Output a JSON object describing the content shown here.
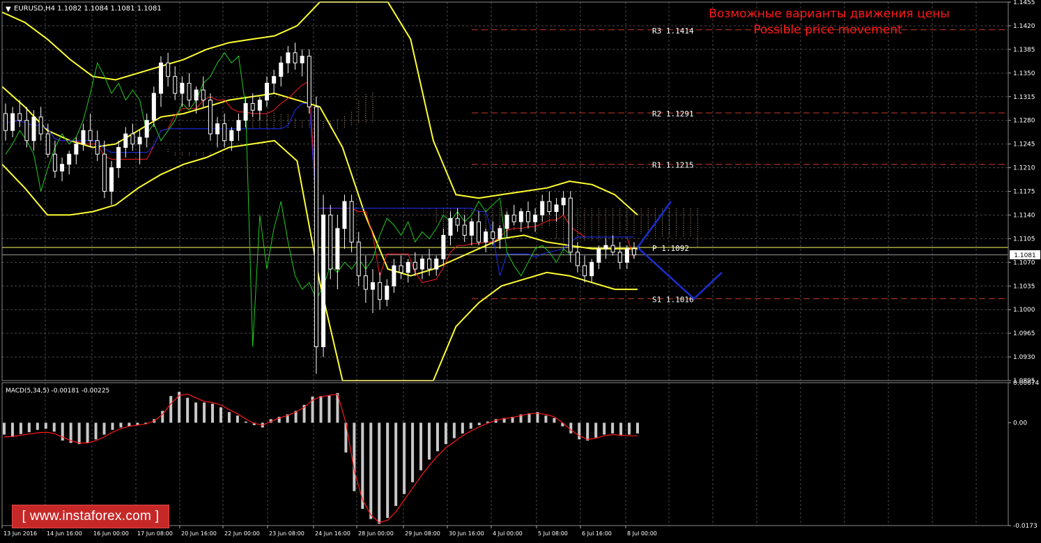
{
  "window": {
    "symbol_info": "EURUSD,H4  1.1082 1.1084 1.1081 1.1081",
    "indicator_info": "MACD(5,34,5) -0.00181 -0.00225",
    "current_price": "1.1081",
    "annotation_ru": "Возможные варианты движения цены",
    "annotation_en": "Possible price movement",
    "watermark": "[ www.instaforex.com ]"
  },
  "colors": {
    "background": "#000000",
    "grid": "#4a4a4a",
    "axis_text": "#ffffff",
    "bull_candle": "#ffffff",
    "bear_candle": "#000000",
    "bollinger": "#ffff33",
    "ichimoku_tenkan": "#ff2020",
    "ichimoku_kijun": "#2030ff",
    "ichimoku_chikou": "#22cc22",
    "kumo": "#d9a88a",
    "pivot_levels": "#c83a28",
    "pivot_line": "#ffff66",
    "forecast": "#1a2fd0",
    "macd_hist": "#c8c8c8",
    "macd_signal": "#ff1a1a",
    "annotation": "#ff1a1a"
  },
  "chart_data": [
    {
      "type": "candlestick",
      "symbol": "EURUSD",
      "timeframe": "H4",
      "ylim": [
        1.0895,
        1.1455
      ],
      "y_ticks": [
        "1.1455",
        "1.1420",
        "1.1385",
        "1.1350",
        "1.1315",
        "1.1280",
        "1.1245",
        "1.1210",
        "1.1175",
        "1.1140",
        "1.1105",
        "1.1070",
        "1.1035",
        "1.1000",
        "1.0965",
        "1.0930",
        "1.0895"
      ],
      "x_ticks": [
        "13 Jun 2016",
        "14 Jun 16:00",
        "16 Jun 00:00",
        "17 Jun 08:00",
        "20 Jun 16:00",
        "22 Jun 00:00",
        "23 Jun 08:00",
        "24 Jun 16:00",
        "28 Jun 00:00",
        "29 Jun 08:00",
        "30 Jun 16:00",
        "4 Jul 00:00",
        "5 Jul 08:00",
        "6 Jul 16:00",
        "8 Jul 00:00"
      ],
      "levels": [
        {
          "label": "R3",
          "value": 1.1414
        },
        {
          "label": "R2",
          "value": 1.1291
        },
        {
          "label": "R1",
          "value": 1.1215
        },
        {
          "label": "P",
          "value": 1.1092
        },
        {
          "label": "S1",
          "value": 1.1016
        }
      ],
      "level_labels": [
        "R3  1.1414",
        "R2  1.1291",
        "R1  1.1215",
        "P  1.1092",
        "S1  1.1016"
      ],
      "last_price": 1.1081,
      "candles_ohlc": [
        [
          1.129,
          1.1305,
          1.125,
          1.1265
        ],
        [
          1.1265,
          1.13,
          1.1255,
          1.129
        ],
        [
          1.129,
          1.131,
          1.127,
          1.128
        ],
        [
          1.128,
          1.13,
          1.124,
          1.125
        ],
        [
          1.125,
          1.1295,
          1.1235,
          1.1285
        ],
        [
          1.1285,
          1.13,
          1.125,
          1.126
        ],
        [
          1.126,
          1.1275,
          1.1225,
          1.123
        ],
        [
          1.123,
          1.125,
          1.1195,
          1.1205
        ],
        [
          1.1205,
          1.1225,
          1.119,
          1.1215
        ],
        [
          1.1215,
          1.1235,
          1.12,
          1.123
        ],
        [
          1.123,
          1.1255,
          1.1215,
          1.1245
        ],
        [
          1.1245,
          1.1275,
          1.1235,
          1.1265
        ],
        [
          1.1265,
          1.129,
          1.124,
          1.125
        ],
        [
          1.125,
          1.1265,
          1.122,
          1.123
        ],
        [
          1.123,
          1.125,
          1.1165,
          1.1175
        ],
        [
          1.1175,
          1.122,
          1.1155,
          1.121
        ],
        [
          1.121,
          1.125,
          1.1195,
          1.124
        ],
        [
          1.124,
          1.127,
          1.1225,
          1.126
        ],
        [
          1.126,
          1.1275,
          1.1235,
          1.1245
        ],
        [
          1.1245,
          1.1265,
          1.1215,
          1.1255
        ],
        [
          1.1255,
          1.129,
          1.124,
          1.128
        ],
        [
          1.128,
          1.133,
          1.127,
          1.132
        ],
        [
          1.132,
          1.1375,
          1.13,
          1.1365
        ],
        [
          1.1365,
          1.138,
          1.133,
          1.1345
        ],
        [
          1.1345,
          1.136,
          1.131,
          1.132
        ],
        [
          1.132,
          1.1345,
          1.13,
          1.1335
        ],
        [
          1.1335,
          1.135,
          1.13,
          1.131
        ],
        [
          1.131,
          1.133,
          1.129,
          1.1325
        ],
        [
          1.1325,
          1.1345,
          1.13,
          1.131
        ],
        [
          1.131,
          1.132,
          1.125,
          1.126
        ],
        [
          1.126,
          1.1285,
          1.124,
          1.1275
        ],
        [
          1.1275,
          1.129,
          1.124,
          1.125
        ],
        [
          1.125,
          1.127,
          1.1235,
          1.1265
        ],
        [
          1.1265,
          1.129,
          1.125,
          1.128
        ],
        [
          1.128,
          1.1315,
          1.127,
          1.1305
        ],
        [
          1.1305,
          1.132,
          1.1285,
          1.1295
        ],
        [
          1.1295,
          1.1315,
          1.128,
          1.131
        ],
        [
          1.131,
          1.1345,
          1.13,
          1.1335
        ],
        [
          1.1335,
          1.1355,
          1.132,
          1.1345
        ],
        [
          1.1345,
          1.1375,
          1.133,
          1.1365
        ],
        [
          1.1365,
          1.139,
          1.135,
          1.138
        ],
        [
          1.138,
          1.1395,
          1.1355,
          1.1365
        ],
        [
          1.1365,
          1.1385,
          1.1345,
          1.1375
        ],
        [
          1.1375,
          1.1385,
          1.129,
          1.13
        ],
        [
          1.13,
          1.1315,
          1.0905,
          1.0945
        ],
        [
          1.0945,
          1.117,
          1.093,
          1.114
        ],
        [
          1.114,
          1.1155,
          1.1045,
          1.106
        ],
        [
          1.106,
          1.114,
          1.103,
          1.112
        ],
        [
          1.112,
          1.117,
          1.109,
          1.116
        ],
        [
          1.116,
          1.117,
          1.1085,
          1.11
        ],
        [
          1.11,
          1.1115,
          1.1035,
          1.105
        ],
        [
          1.105,
          1.108,
          1.101,
          1.103
        ],
        [
          1.103,
          1.106,
          1.0995,
          1.104
        ],
        [
          1.104,
          1.1055,
          1.1,
          1.1015
        ],
        [
          1.1015,
          1.1045,
          1.1005,
          1.1035
        ],
        [
          1.1035,
          1.1075,
          1.1025,
          1.1065
        ],
        [
          1.1065,
          1.108,
          1.1045,
          1.1055
        ],
        [
          1.1055,
          1.1075,
          1.104,
          1.107
        ],
        [
          1.107,
          1.1085,
          1.105,
          1.106
        ],
        [
          1.106,
          1.108,
          1.1045,
          1.1075
        ],
        [
          1.1075,
          1.109,
          1.105,
          1.106
        ],
        [
          1.106,
          1.108,
          1.105,
          1.1075
        ],
        [
          1.1075,
          1.112,
          1.1065,
          1.111
        ],
        [
          1.111,
          1.1145,
          1.1095,
          1.1135
        ],
        [
          1.1135,
          1.115,
          1.1115,
          1.1125
        ],
        [
          1.1125,
          1.114,
          1.11,
          1.111
        ],
        [
          1.111,
          1.1135,
          1.1095,
          1.113
        ],
        [
          1.113,
          1.1145,
          1.1095,
          1.11
        ],
        [
          1.11,
          1.112,
          1.1085,
          1.1115
        ],
        [
          1.1115,
          1.113,
          1.1095,
          1.1105
        ],
        [
          1.1105,
          1.1125,
          1.109,
          1.112
        ],
        [
          1.112,
          1.1145,
          1.1105,
          1.114
        ],
        [
          1.114,
          1.1155,
          1.1125,
          1.113
        ],
        [
          1.113,
          1.115,
          1.1115,
          1.1145
        ],
        [
          1.1145,
          1.116,
          1.112,
          1.113
        ],
        [
          1.113,
          1.115,
          1.1115,
          1.114
        ],
        [
          1.114,
          1.117,
          1.113,
          1.116
        ],
        [
          1.116,
          1.1175,
          1.114,
          1.1145
        ],
        [
          1.1145,
          1.1165,
          1.113,
          1.1155
        ],
        [
          1.1155,
          1.1175,
          1.114,
          1.1165
        ],
        [
          1.1165,
          1.1175,
          1.107,
          1.1085
        ],
        [
          1.1085,
          1.11,
          1.1055,
          1.1065
        ],
        [
          1.1065,
          1.108,
          1.104,
          1.105
        ],
        [
          1.105,
          1.1075,
          1.104,
          1.107
        ],
        [
          1.107,
          1.1095,
          1.106,
          1.109
        ],
        [
          1.109,
          1.1105,
          1.1075,
          1.1095
        ],
        [
          1.1095,
          1.111,
          1.108,
          1.1085
        ],
        [
          1.1085,
          1.11,
          1.106,
          1.107
        ],
        [
          1.107,
          1.1095,
          1.106,
          1.109
        ],
        [
          1.109,
          1.11,
          1.1075,
          1.1081
        ]
      ],
      "bollinger_upper": [
        1.144,
        1.1425,
        1.14,
        1.137,
        1.1345,
        1.134,
        1.135,
        1.136,
        1.137,
        1.1385,
        1.1395,
        1.14,
        1.1405,
        1.142,
        1.1455,
        1.15,
        1.156,
        1.154,
        1.14,
        1.125,
        1.117,
        1.1165,
        1.117,
        1.1175,
        1.118,
        1.119,
        1.1185,
        1.117,
        1.114
      ],
      "bollinger_middle": [
        1.133,
        1.13,
        1.1265,
        1.125,
        1.124,
        1.1245,
        1.1265,
        1.1285,
        1.129,
        1.13,
        1.131,
        1.1315,
        1.132,
        1.131,
        1.13,
        1.124,
        1.114,
        1.106,
        1.105,
        1.106,
        1.1075,
        1.109,
        1.1105,
        1.111,
        1.11,
        1.1095,
        1.109,
        1.109,
        1.109
      ],
      "bollinger_lower": [
        1.1215,
        1.118,
        1.114,
        1.114,
        1.1145,
        1.1155,
        1.118,
        1.12,
        1.1215,
        1.1225,
        1.124,
        1.1245,
        1.125,
        1.122,
        1.104,
        1.08,
        1.065,
        1.06,
        1.07,
        1.084,
        1.0975,
        1.101,
        1.1035,
        1.1045,
        1.1055,
        1.105,
        1.104,
        1.103,
        1.103
      ],
      "forecast_path": [
        [
          1.1092,
          1.116
        ],
        [
          1.1092,
          1.1016,
          1.1055
        ]
      ],
      "annotation_ru": "Возможные варианты движения цены",
      "annotation_en": "Possible price movement"
    },
    {
      "type": "bar",
      "name": "MACD(5,34,5)",
      "values_label": "MACD(5,34,5) -0.00181 -0.00225",
      "ylim": [
        -0.0173,
        0.00674
      ],
      "y_ticks": [
        "0.00674",
        "0.00",
        "-0.0173"
      ],
      "values": [
        -0.002,
        -0.0024,
        -0.0019,
        -0.0016,
        -0.0012,
        -0.001,
        -0.0015,
        -0.003,
        -0.0034,
        -0.0036,
        -0.0034,
        -0.0028,
        -0.002,
        -0.0012,
        -0.0008,
        -0.0006,
        -0.0004,
        -0.0002,
        0.0006,
        0.002,
        0.0045,
        0.0052,
        0.0042,
        0.0034,
        0.0034,
        0.0032,
        0.0026,
        0.0018,
        0.0012,
        0.0002,
        -0.0004,
        -0.0008,
        0.0006,
        0.001,
        0.0014,
        0.002,
        0.003,
        0.0044,
        0.0045,
        0.0046,
        0.005,
        -0.005,
        -0.0115,
        -0.0145,
        -0.0162,
        -0.017,
        -0.016,
        -0.014,
        -0.012,
        -0.01,
        -0.008,
        -0.0062,
        -0.0048,
        -0.0036,
        -0.0026,
        -0.0018,
        -0.001,
        -0.0004,
        0.0002,
        0.0006,
        0.0008,
        0.001,
        0.0014,
        0.0016,
        0.0018,
        0.0012,
        0.0008,
        -0.0006,
        -0.0018,
        -0.0028,
        -0.003,
        -0.0025,
        -0.002,
        -0.0018,
        -0.0022,
        -0.002,
        -0.0018
      ],
      "signal": [
        -0.0024,
        -0.0023,
        -0.0021,
        -0.0019,
        -0.0017,
        -0.0016,
        -0.0018,
        -0.0024,
        -0.003,
        -0.0034,
        -0.0034,
        -0.003,
        -0.0024,
        -0.0016,
        -0.001,
        -0.0006,
        -0.0004,
        -0.0002,
        0.0003,
        0.0014,
        0.0032,
        0.0046,
        0.0048,
        0.0042,
        0.0036,
        0.0034,
        0.003,
        0.0022,
        0.0015,
        0.0006,
        -0.0001,
        -0.0004,
        0.0002,
        0.0008,
        0.0012,
        0.0018,
        0.0026,
        0.0038,
        0.0044,
        0.0046,
        0.0048,
        0.0,
        -0.008,
        -0.013,
        -0.0155,
        -0.0168,
        -0.0164,
        -0.015,
        -0.013,
        -0.011,
        -0.009,
        -0.0072,
        -0.0056,
        -0.0042,
        -0.0032,
        -0.0022,
        -0.0014,
        -0.0007,
        -0.0001,
        0.0004,
        0.0007,
        0.0009,
        0.0012,
        0.0015,
        0.0016,
        0.0014,
        0.001,
        0.0,
        -0.0012,
        -0.0022,
        -0.0028,
        -0.0026,
        -0.0022,
        -0.002,
        -0.0021,
        -0.0022,
        -0.0022
      ]
    }
  ]
}
